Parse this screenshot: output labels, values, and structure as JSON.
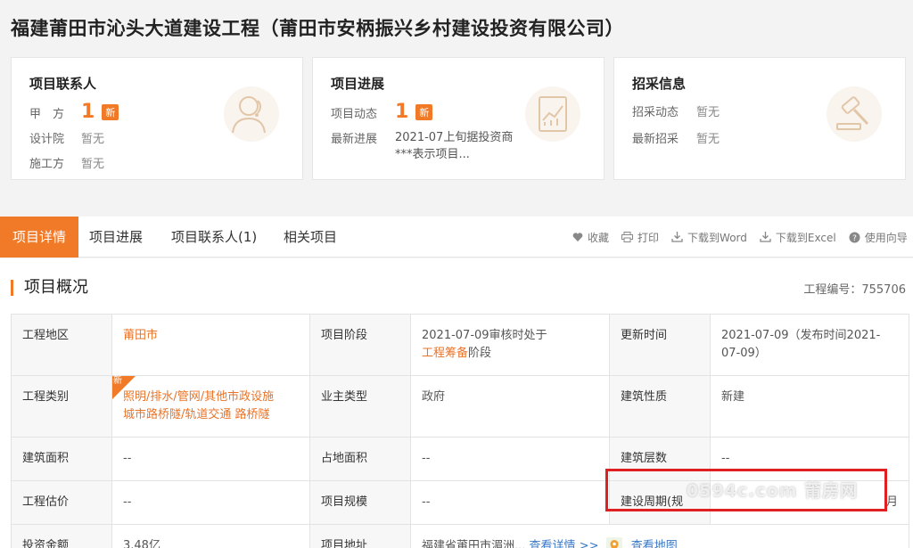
{
  "page_title": "福建莆田市沁头大道建设工程（莆田市安柄振兴乡村建设投资有限公司）",
  "cards": {
    "contacts": {
      "title": "项目联系人",
      "rows": [
        {
          "label": "甲　方",
          "count": "1",
          "badge": "新"
        },
        {
          "label": "设计院",
          "value": "暂无"
        },
        {
          "label": "施工方",
          "value": "暂无"
        }
      ]
    },
    "progress": {
      "title": "项目进展",
      "dynamic_label": "项目动态",
      "dynamic_count": "1",
      "badge": "新",
      "latest_label": "最新进展",
      "latest_value": "2021-07上旬据投资商***表示项目..."
    },
    "procurement": {
      "title": "招采信息",
      "rows": [
        {
          "label": "招采动态",
          "value": "暂无"
        },
        {
          "label": "最新招采",
          "value": "暂无"
        }
      ]
    }
  },
  "tabs": [
    {
      "label": "项目详情",
      "active": true
    },
    {
      "label": "项目进展"
    },
    {
      "label": "项目联系人(1)"
    },
    {
      "label": "相关项目"
    }
  ],
  "tools": [
    {
      "label": "收藏",
      "icon": "heart-icon"
    },
    {
      "label": "打印",
      "icon": "printer-icon"
    },
    {
      "label": "下载到Word",
      "icon": "download-icon"
    },
    {
      "label": "下载到Excel",
      "icon": "download-icon"
    },
    {
      "label": "使用向导",
      "icon": "help-icon"
    }
  ],
  "section": {
    "title": "项目概况",
    "project_no": "工程编号：755706"
  },
  "overview": {
    "r1": {
      "k1": "工程地区",
      "v1": "莆田市",
      "k2": "项目阶段",
      "v2a": "2021-07-09审核时处于",
      "v2b": "工程筹备",
      "v2c": "阶段",
      "k3": "更新时间",
      "v3": "2021-07-09（发布时间2021-07-09）"
    },
    "r2": {
      "k1": "工程类别",
      "badge": "新",
      "v1a": "照明/排水/管网/其他市政设施",
      "v1b": "城市路桥隧/轨道交通 路桥隧",
      "k2": "业主类型",
      "v2": "政府",
      "k3": "建筑性质",
      "v3": "新建"
    },
    "r3": {
      "k1": "建筑面积",
      "v1": "--",
      "k2": "占地面积",
      "v2": "--",
      "k3": "建筑层数",
      "v3": "--"
    },
    "r4": {
      "k1": "工程估价",
      "v1": "--",
      "k2": "项目规模",
      "v2": "--",
      "k3": "建设周期(规",
      "v3": "月"
    },
    "r5": {
      "k1": "投资金额",
      "v1": "3.48亿",
      "k2": "项目地址",
      "v2": "福建省莆田市湄洲...",
      "detail_link": "查看详情 >>",
      "map_link": "查看地图"
    }
  },
  "watermark": "0594c.com 莆房网",
  "colors": {
    "accent": "#f07a28",
    "link": "#3a78c7",
    "highlight_box": "#e02020"
  }
}
